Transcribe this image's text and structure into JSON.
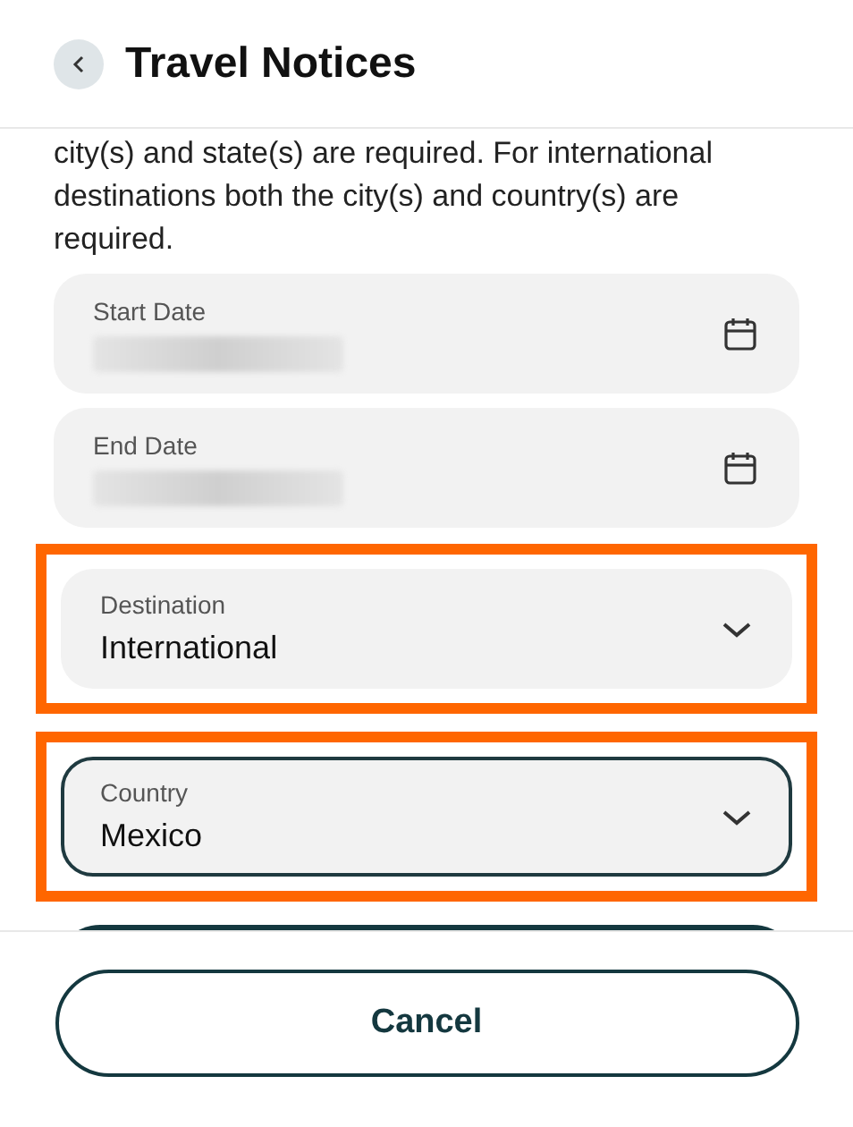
{
  "header": {
    "title": "Travel Notices"
  },
  "instructions": "city(s) and state(s) are required. For international destinations both the city(s) and country(s) are required.",
  "fields": [
    {
      "kind": "date",
      "label": "Start Date",
      "value_hidden": true,
      "highlighted": false,
      "focused": false
    },
    {
      "kind": "date",
      "label": "End Date",
      "value_hidden": true,
      "highlighted": false,
      "focused": false
    },
    {
      "kind": "select",
      "label": "Destination",
      "value": "International",
      "highlighted": true,
      "focused": false
    },
    {
      "kind": "select",
      "label": "Country",
      "value": "Mexico",
      "highlighted": true,
      "focused": true
    }
  ],
  "footer": {
    "cancel": "Cancel"
  }
}
